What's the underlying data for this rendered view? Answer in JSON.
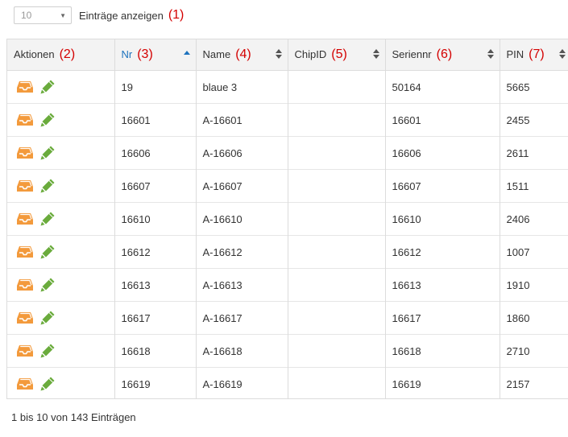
{
  "length_menu": {
    "selected": "10",
    "label": "Einträge anzeigen",
    "annotation": "(1)"
  },
  "columns": [
    {
      "label": "Aktionen",
      "annotation": "(2)",
      "sortable": false
    },
    {
      "label": "Nr",
      "annotation": "(3)",
      "sortable": true,
      "sorted": "asc"
    },
    {
      "label": "Name",
      "annotation": "(4)",
      "sortable": true
    },
    {
      "label": "ChipID",
      "annotation": "(5)",
      "sortable": true
    },
    {
      "label": "Seriennr",
      "annotation": "(6)",
      "sortable": true
    },
    {
      "label": "PIN",
      "annotation": "(7)",
      "sortable": true
    }
  ],
  "rows": [
    {
      "nr": "19",
      "name": "blaue 3",
      "chipid": "",
      "seriennr": "50164",
      "pin": "5665"
    },
    {
      "nr": "16601",
      "name": "A-16601",
      "chipid": "",
      "seriennr": "16601",
      "pin": "2455"
    },
    {
      "nr": "16606",
      "name": "A-16606",
      "chipid": "",
      "seriennr": "16606",
      "pin": "2611"
    },
    {
      "nr": "16607",
      "name": "A-16607",
      "chipid": "",
      "seriennr": "16607",
      "pin": "1511"
    },
    {
      "nr": "16610",
      "name": "A-16610",
      "chipid": "",
      "seriennr": "16610",
      "pin": "2406"
    },
    {
      "nr": "16612",
      "name": "A-16612",
      "chipid": "",
      "seriennr": "16612",
      "pin": "1007"
    },
    {
      "nr": "16613",
      "name": "A-16613",
      "chipid": "",
      "seriennr": "16613",
      "pin": "1910"
    },
    {
      "nr": "16617",
      "name": "A-16617",
      "chipid": "",
      "seriennr": "16617",
      "pin": "1860"
    },
    {
      "nr": "16618",
      "name": "A-16618",
      "chipid": "",
      "seriennr": "16618",
      "pin": "2710"
    },
    {
      "nr": "16619",
      "name": "A-16619",
      "chipid": "",
      "seriennr": "16619",
      "pin": "2157"
    }
  ],
  "row_actions": {
    "archive_icon": "inbox-icon",
    "edit_icon": "pencil-icon"
  },
  "colors": {
    "archive": "#f39a3c",
    "edit": "#6aab3c",
    "sorted_header": "#1e73be",
    "annotation": "#d40000"
  },
  "info": "1 bis 10 von 143 Einträgen"
}
